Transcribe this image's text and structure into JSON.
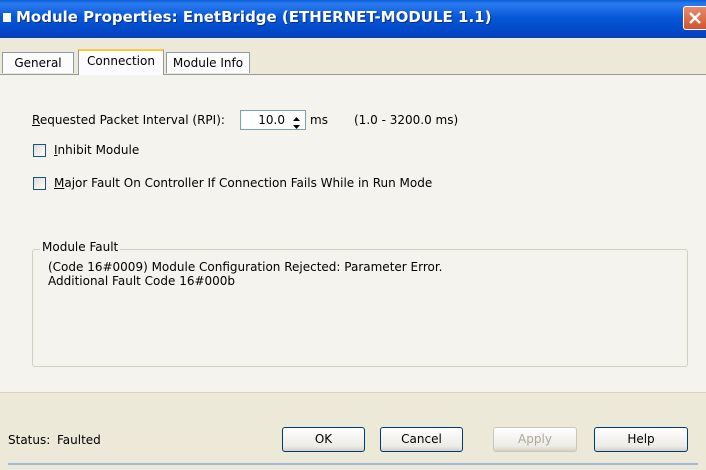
{
  "window": {
    "title": "Module Properties: EnetBridge (ETHERNET-MODULE 1.1)",
    "close_icon": "close-icon"
  },
  "tabs": [
    {
      "label": "General",
      "active": false
    },
    {
      "label": "Connection",
      "active": true
    },
    {
      "label": "Module Info",
      "active": false
    }
  ],
  "connection": {
    "rpi_label": "Requested Packet Interval (RPI):",
    "rpi_value": "10.0",
    "rpi_unit": "ms",
    "rpi_range": "(1.0 - 3200.0 ms)",
    "inhibit_label": "Inhibit Module",
    "inhibit_checked": false,
    "major_fault_label": "Major Fault On Controller If Connection Fails While in Run Mode",
    "major_fault_checked": false
  },
  "module_fault": {
    "title": "Module Fault",
    "line1": "(Code 16#0009) Module Configuration Rejected: Parameter Error.",
    "line2": "Additional Fault Code 16#000b"
  },
  "status": {
    "label": "Status:",
    "value": "Faulted"
  },
  "buttons": {
    "ok": "OK",
    "cancel": "Cancel",
    "apply": "Apply",
    "help": "Help"
  },
  "colors": {
    "titlebar": "#0758d8",
    "close_button": "#d4532a",
    "dialog_background": "#ece9d8",
    "active_tab_highlight": "#ffc83c"
  }
}
